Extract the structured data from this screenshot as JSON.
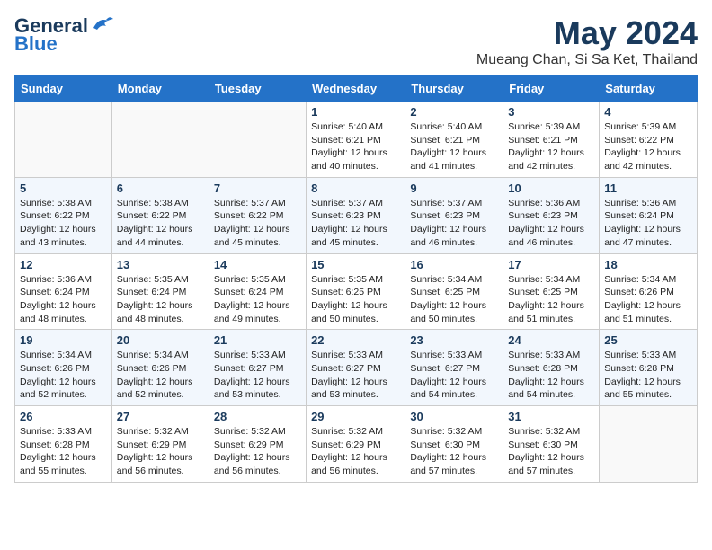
{
  "header": {
    "logo_general": "General",
    "logo_blue": "Blue",
    "title": "May 2024",
    "subtitle": "Mueang Chan, Si Sa Ket, Thailand"
  },
  "weekdays": [
    "Sunday",
    "Monday",
    "Tuesday",
    "Wednesday",
    "Thursday",
    "Friday",
    "Saturday"
  ],
  "weeks": [
    [
      {
        "day": "",
        "info": ""
      },
      {
        "day": "",
        "info": ""
      },
      {
        "day": "",
        "info": ""
      },
      {
        "day": "1",
        "info": "Sunrise: 5:40 AM\nSunset: 6:21 PM\nDaylight: 12 hours\nand 40 minutes."
      },
      {
        "day": "2",
        "info": "Sunrise: 5:40 AM\nSunset: 6:21 PM\nDaylight: 12 hours\nand 41 minutes."
      },
      {
        "day": "3",
        "info": "Sunrise: 5:39 AM\nSunset: 6:21 PM\nDaylight: 12 hours\nand 42 minutes."
      },
      {
        "day": "4",
        "info": "Sunrise: 5:39 AM\nSunset: 6:22 PM\nDaylight: 12 hours\nand 42 minutes."
      }
    ],
    [
      {
        "day": "5",
        "info": "Sunrise: 5:38 AM\nSunset: 6:22 PM\nDaylight: 12 hours\nand 43 minutes."
      },
      {
        "day": "6",
        "info": "Sunrise: 5:38 AM\nSunset: 6:22 PM\nDaylight: 12 hours\nand 44 minutes."
      },
      {
        "day": "7",
        "info": "Sunrise: 5:37 AM\nSunset: 6:22 PM\nDaylight: 12 hours\nand 45 minutes."
      },
      {
        "day": "8",
        "info": "Sunrise: 5:37 AM\nSunset: 6:23 PM\nDaylight: 12 hours\nand 45 minutes."
      },
      {
        "day": "9",
        "info": "Sunrise: 5:37 AM\nSunset: 6:23 PM\nDaylight: 12 hours\nand 46 minutes."
      },
      {
        "day": "10",
        "info": "Sunrise: 5:36 AM\nSunset: 6:23 PM\nDaylight: 12 hours\nand 46 minutes."
      },
      {
        "day": "11",
        "info": "Sunrise: 5:36 AM\nSunset: 6:24 PM\nDaylight: 12 hours\nand 47 minutes."
      }
    ],
    [
      {
        "day": "12",
        "info": "Sunrise: 5:36 AM\nSunset: 6:24 PM\nDaylight: 12 hours\nand 48 minutes."
      },
      {
        "day": "13",
        "info": "Sunrise: 5:35 AM\nSunset: 6:24 PM\nDaylight: 12 hours\nand 48 minutes."
      },
      {
        "day": "14",
        "info": "Sunrise: 5:35 AM\nSunset: 6:24 PM\nDaylight: 12 hours\nand 49 minutes."
      },
      {
        "day": "15",
        "info": "Sunrise: 5:35 AM\nSunset: 6:25 PM\nDaylight: 12 hours\nand 50 minutes."
      },
      {
        "day": "16",
        "info": "Sunrise: 5:34 AM\nSunset: 6:25 PM\nDaylight: 12 hours\nand 50 minutes."
      },
      {
        "day": "17",
        "info": "Sunrise: 5:34 AM\nSunset: 6:25 PM\nDaylight: 12 hours\nand 51 minutes."
      },
      {
        "day": "18",
        "info": "Sunrise: 5:34 AM\nSunset: 6:26 PM\nDaylight: 12 hours\nand 51 minutes."
      }
    ],
    [
      {
        "day": "19",
        "info": "Sunrise: 5:34 AM\nSunset: 6:26 PM\nDaylight: 12 hours\nand 52 minutes."
      },
      {
        "day": "20",
        "info": "Sunrise: 5:34 AM\nSunset: 6:26 PM\nDaylight: 12 hours\nand 52 minutes."
      },
      {
        "day": "21",
        "info": "Sunrise: 5:33 AM\nSunset: 6:27 PM\nDaylight: 12 hours\nand 53 minutes."
      },
      {
        "day": "22",
        "info": "Sunrise: 5:33 AM\nSunset: 6:27 PM\nDaylight: 12 hours\nand 53 minutes."
      },
      {
        "day": "23",
        "info": "Sunrise: 5:33 AM\nSunset: 6:27 PM\nDaylight: 12 hours\nand 54 minutes."
      },
      {
        "day": "24",
        "info": "Sunrise: 5:33 AM\nSunset: 6:28 PM\nDaylight: 12 hours\nand 54 minutes."
      },
      {
        "day": "25",
        "info": "Sunrise: 5:33 AM\nSunset: 6:28 PM\nDaylight: 12 hours\nand 55 minutes."
      }
    ],
    [
      {
        "day": "26",
        "info": "Sunrise: 5:33 AM\nSunset: 6:28 PM\nDaylight: 12 hours\nand 55 minutes."
      },
      {
        "day": "27",
        "info": "Sunrise: 5:32 AM\nSunset: 6:29 PM\nDaylight: 12 hours\nand 56 minutes."
      },
      {
        "day": "28",
        "info": "Sunrise: 5:32 AM\nSunset: 6:29 PM\nDaylight: 12 hours\nand 56 minutes."
      },
      {
        "day": "29",
        "info": "Sunrise: 5:32 AM\nSunset: 6:29 PM\nDaylight: 12 hours\nand 56 minutes."
      },
      {
        "day": "30",
        "info": "Sunrise: 5:32 AM\nSunset: 6:30 PM\nDaylight: 12 hours\nand 57 minutes."
      },
      {
        "day": "31",
        "info": "Sunrise: 5:32 AM\nSunset: 6:30 PM\nDaylight: 12 hours\nand 57 minutes."
      },
      {
        "day": "",
        "info": ""
      }
    ]
  ]
}
